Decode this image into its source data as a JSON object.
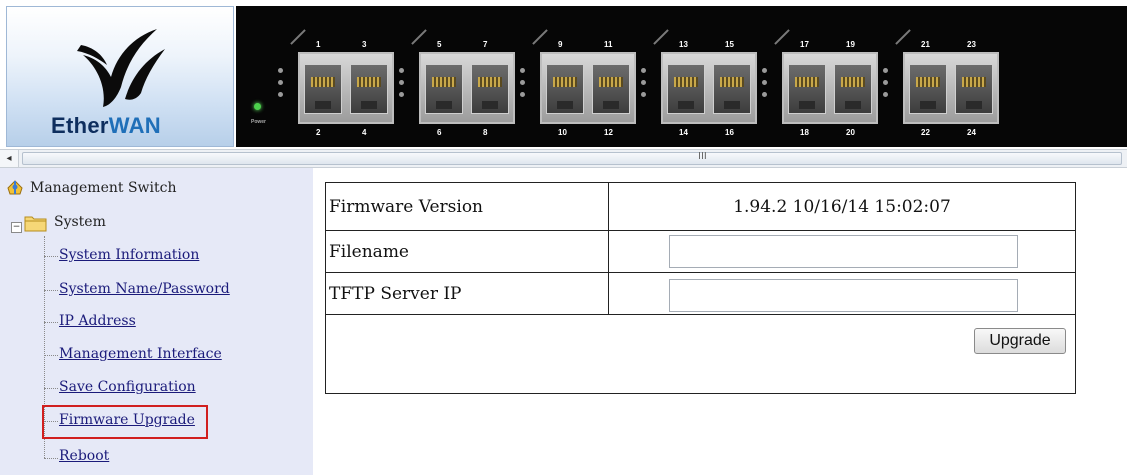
{
  "header": {
    "brand": {
      "part1": "Ether",
      "part2": "WAN"
    },
    "port_labels_top": [
      "1",
      "3",
      "5",
      "7",
      "9",
      "11",
      "13",
      "15",
      "17",
      "19",
      "21",
      "23"
    ],
    "port_labels_bottom": [
      "2",
      "4",
      "6",
      "8",
      "10",
      "12",
      "14",
      "16",
      "18",
      "20",
      "22",
      "24"
    ],
    "power_label": "Power"
  },
  "scrollbar": {
    "left_arrow": "◂",
    "grip": "III"
  },
  "sidebar": {
    "root": "Management Switch",
    "system": "System",
    "items": [
      {
        "label": "System Information"
      },
      {
        "label": "System Name/Password"
      },
      {
        "label": "IP Address"
      },
      {
        "label": "Management Interface"
      },
      {
        "label": "Save Configuration"
      },
      {
        "label": "Firmware Upgrade",
        "highlighted": true
      },
      {
        "label": "Reboot"
      }
    ],
    "highlight_color": "#d11f1f"
  },
  "main": {
    "firmware_version_label": "Firmware Version",
    "firmware_version_value": "1.94.2 10/16/14 15:02:07",
    "filename_label": "Filename",
    "filename_value": "",
    "tftp_label": "TFTP Server IP",
    "tftp_value": "",
    "upgrade_button": "Upgrade"
  }
}
